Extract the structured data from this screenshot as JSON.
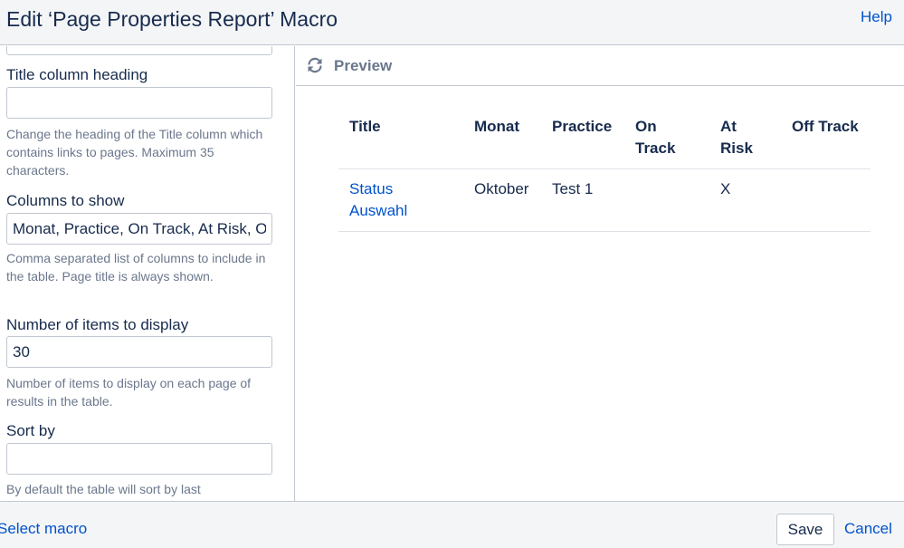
{
  "header": {
    "title": "Edit ‘Page Properties Report’ Macro",
    "help_label": "Help"
  },
  "form": {
    "title_heading": {
      "label": "Title column heading",
      "value": "",
      "description": "Change the heading of the Title column which contains links to pages. Maximum 35 characters."
    },
    "columns": {
      "label": "Columns to show",
      "value": "Monat, Practice, On Track, At Risk, Off Track",
      "description": "Comma separated list of columns to include in the table. Page title is always shown."
    },
    "items": {
      "label": "Number of items to display",
      "value": "30",
      "description": "Number of items to display on each page of results in the table."
    },
    "sort": {
      "label": "Sort by",
      "value": "",
      "description": "By default the table will sort by last"
    }
  },
  "preview": {
    "label": "Preview",
    "table": {
      "headers": {
        "title": "Title",
        "monat": "Monat",
        "practice": "Practice",
        "on_track": "On Track",
        "at_risk": "At Risk",
        "off_track": "Off Track"
      },
      "rows": [
        {
          "title": "Status Auswahl",
          "monat": "Oktober",
          "practice": "Test 1",
          "on_track": "",
          "at_risk": "X",
          "off_track": ""
        }
      ]
    }
  },
  "footer": {
    "select_macro_label": "Select macro",
    "save_label": "Save",
    "cancel_label": "Cancel"
  },
  "colors": {
    "link": "#0052cc",
    "text": "#172b4d",
    "muted": "#6b778c",
    "border": "#c1c7d0",
    "chrome_bg": "#f4f5f7"
  }
}
